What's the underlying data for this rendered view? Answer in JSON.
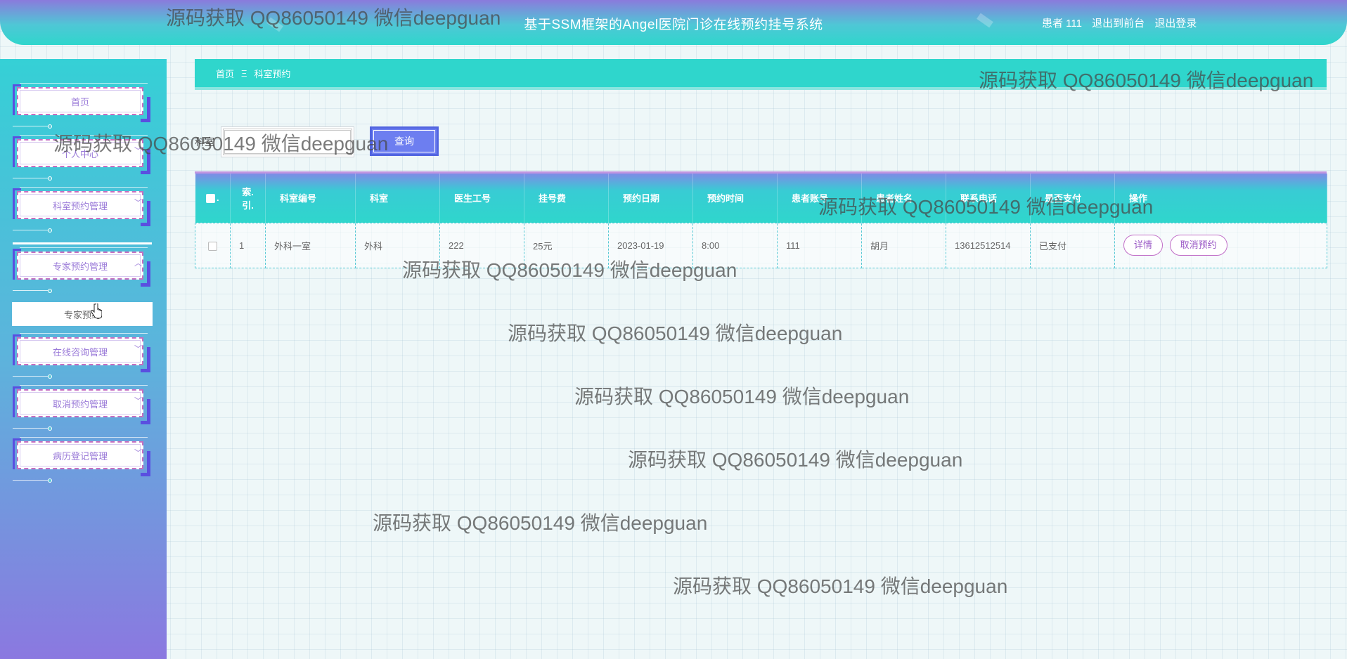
{
  "header": {
    "title": "基于SSM框架的Angel医院门诊在线预约挂号系统",
    "user_label": "患者 111",
    "back_to_front": "退出到前台",
    "logout": "退出登录"
  },
  "sidebar": {
    "items": [
      {
        "label": "首页",
        "expandable": false
      },
      {
        "label": "个人中心",
        "expandable": true
      },
      {
        "label": "科室预约管理",
        "expandable": true
      },
      {
        "label": "专家预约管理",
        "expandable": true,
        "expanded": true
      },
      {
        "label": "在线咨询管理",
        "expandable": true
      },
      {
        "label": "取消预约管理",
        "expandable": true
      },
      {
        "label": "病历登记管理",
        "expandable": true
      }
    ],
    "submenu_item": "专家预约",
    "chevron_down": "﹀",
    "chevron_up": "︿"
  },
  "breadcrumb": {
    "home": "首页",
    "separator": "Ξ",
    "current": "科室预约"
  },
  "search": {
    "label": "科室",
    "placeholder": "",
    "value": "",
    "button": "查询"
  },
  "table": {
    "columns": [
      "索引",
      "科室编号",
      "科室",
      "医生工号",
      "挂号费",
      "预约日期",
      "预约时间",
      "患者账号",
      "患者姓名",
      "联系电话",
      "是否支付",
      "操作"
    ],
    "index_header_line1": "索.",
    "index_header_line2": "引.",
    "rows": [
      {
        "index": "1",
        "dept_no": "外科一室",
        "dept": "外科",
        "doctor_no": "222",
        "fee": "25元",
        "date": "2023-01-19",
        "time": "8:00",
        "patient_account": "111",
        "patient_name": "胡月",
        "phone": "13612512514",
        "paid": "已支付",
        "actions": [
          "详情",
          "取消预约"
        ]
      }
    ]
  },
  "watermark": "源码获取 QQ86050149 微信deepguan",
  "colors": {
    "accent_teal": "#2fd6cc",
    "accent_purple": "#8a7bdc",
    "menu_border": "#5a4fe0",
    "button_pink": "#c16fc8"
  }
}
